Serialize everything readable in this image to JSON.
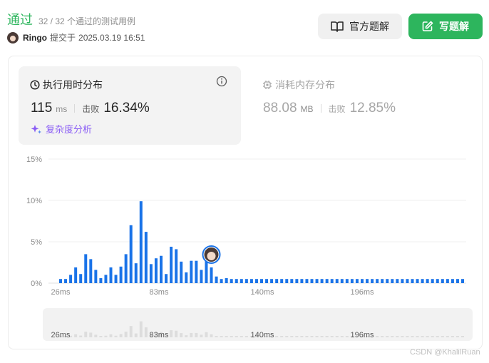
{
  "header": {
    "status": "通过",
    "cases": "32 / 32 个通过的测试用例",
    "author": "Ringo",
    "submitted_label": "提交于",
    "submitted_time": "2025.03.19 16:51"
  },
  "buttons": {
    "official": "官方题解",
    "write": "写题解"
  },
  "runtime": {
    "title": "执行用时分布",
    "value": "115",
    "unit": "ms",
    "beat_label": "击败",
    "beat_pct": "16.34%",
    "complexity": "复杂度分析"
  },
  "memory": {
    "title": "消耗内存分布",
    "value": "88.08",
    "unit": "MB",
    "beat_label": "击败",
    "beat_pct": "12.85%"
  },
  "chart_data": {
    "type": "bar",
    "yticks": [
      "15%",
      "10%",
      "5%",
      "0%"
    ],
    "ylim": [
      0,
      15
    ],
    "xticks": [
      "26ms",
      "83ms",
      "140ms",
      "196ms"
    ],
    "nav_xticks": [
      "26ms",
      "83ms",
      "140ms",
      "196ms"
    ],
    "values": [
      0.5,
      0.5,
      1,
      1.9,
      1.1,
      3.5,
      2.9,
      1.6,
      0.6,
      1,
      1.9,
      1,
      2,
      3.5,
      7,
      2.4,
      9.9,
      6.2,
      2.3,
      3,
      3.3,
      1.1,
      4.4,
      4.1,
      2.6,
      1.3,
      2.7,
      2.7,
      1.6,
      3.2,
      1.9,
      0.8,
      0.5,
      0.6,
      0.5,
      0.5,
      0.5,
      0.5,
      0.5,
      0.5,
      0.5,
      0.5,
      0.5,
      0.5,
      0.5,
      0.5,
      0.5,
      0.5,
      0.5,
      0.5,
      0.5,
      0.5,
      0.5,
      0.5,
      0.5,
      0.5,
      0.5,
      0.5,
      0.5,
      0.5,
      0.5,
      0.5,
      0.5,
      0.5,
      0.5,
      0.5,
      0.5,
      0.5,
      0.5,
      0.5,
      0.5,
      0.5,
      0.5,
      0.5,
      0.5,
      0.5,
      0.5,
      0.5,
      0.5,
      0.5,
      0.5
    ],
    "highlight_index": 30,
    "bar_color": "#1a73e8",
    "nav_bar_color": "#dddddd",
    "grid": true
  },
  "watermark": "CSDN @KhalilRuan"
}
